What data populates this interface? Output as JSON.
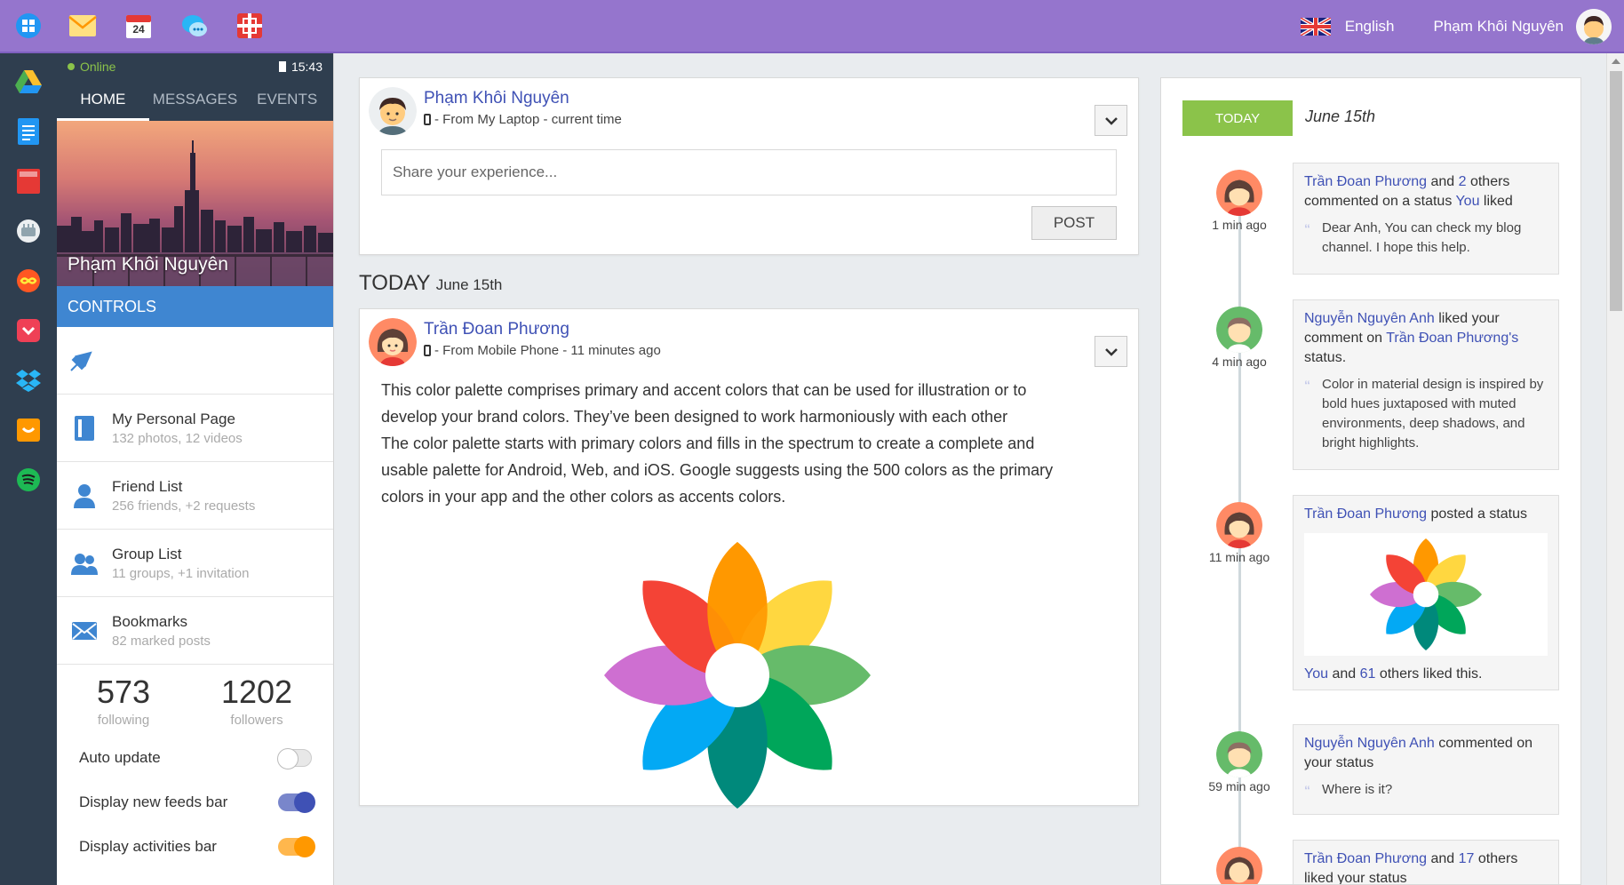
{
  "topbar": {
    "icons": [
      "windows-icon",
      "mail-icon",
      "calendar-icon",
      "chat-icon",
      "gift-icon"
    ],
    "calendar_day": "24",
    "language": "English",
    "user_name": "Phạm Khôi Nguyên"
  },
  "dock": {
    "icons": [
      "google-drive-icon",
      "docs-icon",
      "book-icon",
      "film-icon",
      "infinity-icon",
      "pocket-icon",
      "dropbox-icon",
      "store-icon",
      "spotify-icon"
    ]
  },
  "sidebar": {
    "status": "Online",
    "time": "15:43",
    "tabs": [
      {
        "label": "HOME"
      },
      {
        "label": "MESSAGES"
      },
      {
        "label": "EVENTS"
      }
    ],
    "cover_name": "Phạm Khôi Nguyên",
    "controls_label": "CONTROLS",
    "menu": [
      {
        "title": "My Personal Page",
        "sub": "132 photos, 12 videos"
      },
      {
        "title": "Friend List",
        "sub": "256 friends, +2 requests"
      },
      {
        "title": "Group List",
        "sub": "11 groups, +1 invitation"
      },
      {
        "title": "Bookmarks",
        "sub": "82 marked posts"
      }
    ],
    "stats": [
      {
        "num": "573",
        "label": "following"
      },
      {
        "num": "1202",
        "label": "followers"
      }
    ],
    "toggles": [
      {
        "label": "Auto update",
        "on": false
      },
      {
        "label": "Display new feeds bar",
        "on": true
      },
      {
        "label": "Display activities bar",
        "on": true
      }
    ]
  },
  "composer": {
    "name": "Phạm Khôi Nguyên",
    "meta": "- From My Laptop - current time",
    "placeholder": "Share your experience...",
    "post_label": "POST"
  },
  "today_header": {
    "label": "TODAY",
    "date": "June 15th"
  },
  "post": {
    "name": "Trần Đoan Phương",
    "meta": "- From Mobile Phone - 11 minutes ago",
    "body_lines": [
      "This color palette comprises primary and accent colors that can be used for illustration or to",
      "develop your brand colors. They’ve been designed to work harmoniously with each other",
      "The color palette starts with primary colors and fills in the spectrum to create a complete and",
      "usable palette for Android, Web, and iOS. Google suggests using the 500 colors as the primary",
      "colors in your app and the other colors as accents colors."
    ]
  },
  "timeline": {
    "badge": "TODAY",
    "date": "June 15th",
    "items": [
      {
        "time": "1 min ago",
        "a": "Trần Đoan Phương",
        "t1": " and ",
        "b": "2",
        "t2": " others commented on a status ",
        "c": "You",
        "t3": " liked",
        "quote": "Dear Anh, You can check my blog channel. I hope this help."
      },
      {
        "time": "4 min ago",
        "a": "Nguyễn Nguyên Anh",
        "t1": " liked your comment on ",
        "b": "Trần Đoan Phương's",
        "t2": " status.",
        "quote": "Color in material design is inspired by bold hues juxtaposed with muted environments, deep shadows, and bright highlights."
      },
      {
        "time": "11 min ago",
        "a": "Trần Đoan Phương",
        "t1": " posted a status",
        "like_a": "You",
        "like_t1": " and ",
        "like_b": "61",
        "like_t2": " others liked this."
      },
      {
        "time": "59 min ago",
        "a": "Nguyễn Nguyên Anh",
        "t1": " commented on your status",
        "quote": "Where is it?"
      },
      {
        "a": "Trần Đoan Phương",
        "t1": " and ",
        "b": "17",
        "t2": " others liked your status"
      }
    ]
  }
}
